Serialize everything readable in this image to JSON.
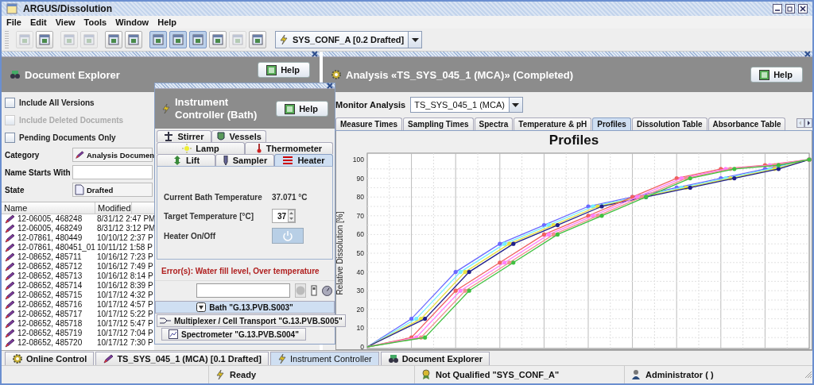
{
  "window": {
    "title": "ARGUS/Dissolution"
  },
  "menu": [
    "File",
    "Edit",
    "View",
    "Tools",
    "Window",
    "Help"
  ],
  "toolbar": {
    "groups": [
      [
        {
          "disabled": true,
          "pressed": false
        },
        {
          "disabled": false,
          "pressed": false
        }
      ],
      [
        {
          "disabled": true,
          "pressed": false
        },
        {
          "disabled": true,
          "pressed": false
        }
      ],
      [
        {
          "disabled": false,
          "pressed": false
        },
        {
          "disabled": false,
          "pressed": false
        }
      ],
      [
        {
          "disabled": false,
          "pressed": true
        },
        {
          "disabled": false,
          "pressed": true
        },
        {
          "disabled": false,
          "pressed": true
        },
        {
          "disabled": false,
          "pressed": false
        },
        {
          "disabled": true,
          "pressed": false
        },
        {
          "disabled": false,
          "pressed": false
        }
      ]
    ],
    "configuration": "SYS_CONF_A [0.2 Drafted]"
  },
  "document_explorer": {
    "title": "Document Explorer",
    "help": "Help",
    "options": [
      {
        "label": "Include All Versions",
        "checked": false,
        "disabled": false
      },
      {
        "label": "Include Deleted Documents",
        "checked": false,
        "disabled": true
      },
      {
        "label": "Pending Documents Only",
        "checked": false,
        "disabled": false
      }
    ],
    "category": {
      "label": "Category",
      "value": "Analysis Documen"
    },
    "name_filter": {
      "label": "Name Starts With"
    },
    "state": {
      "label": "State",
      "value": "Drafted"
    },
    "table": {
      "columns": [
        "Name",
        "Modified"
      ],
      "rows": [
        [
          "12-06005, 468248",
          "8/31/12 2:47 PM"
        ],
        [
          "12-06005, 468249",
          "8/31/12 3:12 PM"
        ],
        [
          "12-07861, 480449",
          "10/10/12 2:37 P"
        ],
        [
          "12-07861, 480451_01",
          "10/11/12 1:58 P"
        ],
        [
          "12-08652, 485711",
          "10/16/12 7:23 P"
        ],
        [
          "12-08652, 485712",
          "10/16/12 7:49 P"
        ],
        [
          "12-08652, 485713",
          "10/16/12 8:14 P"
        ],
        [
          "12-08652, 485714",
          "10/16/12 8:39 P"
        ],
        [
          "12-08652, 485715",
          "10/17/12 4:32 P"
        ],
        [
          "12-08652, 485716",
          "10/17/12 4:57 P"
        ],
        [
          "12-08652, 485717",
          "10/17/12 5:22 P"
        ],
        [
          "12-08652, 485718",
          "10/17/12 5:47 P"
        ],
        [
          "12-08652, 485719",
          "10/17/12 7:04 P"
        ],
        [
          "12-08652, 485720",
          "10/17/12 7:30 P"
        ]
      ]
    }
  },
  "analysis": {
    "title": "Analysis «TS_SYS_045_1 (MCA)» (Completed)",
    "help": "Help",
    "monitor": {
      "label": "Monitor Analysis",
      "value": "TS_SYS_045_1 (MCA)"
    },
    "tabs": [
      {
        "label": "Measure Times",
        "selected": false
      },
      {
        "label": "Sampling Times",
        "selected": false
      },
      {
        "label": "Spectra",
        "selected": false
      },
      {
        "label": "Temperature & pH",
        "selected": false
      },
      {
        "label": "Profiles",
        "selected": true
      },
      {
        "label": "Dissolution Table",
        "selected": false
      },
      {
        "label": "Absorbance Table",
        "selected": false
      }
    ],
    "chart": {
      "title": "Profiles",
      "ylabel": "Relative Dissolution [%]",
      "y_tick_labels": [
        "100",
        "90",
        "80",
        "70",
        "60",
        "50",
        "40",
        "30",
        "20",
        "10",
        "0"
      ]
    }
  },
  "instrument_controller": {
    "title": "Instrument Controller (Bath)",
    "help": "Help",
    "tab_rows": [
      [
        {
          "label": "Stirrer",
          "selected": false
        },
        {
          "label": "Vessels",
          "selected": false
        }
      ],
      [
        {
          "label": "Lamp",
          "selected": false
        },
        {
          "label": "Thermometer",
          "selected": false
        }
      ],
      [
        {
          "label": "Lift",
          "selected": false
        },
        {
          "label": "Sampler",
          "selected": false
        },
        {
          "label": "Heater",
          "selected": true
        }
      ]
    ],
    "fields": [
      {
        "kind": "reading",
        "label": "Current Bath Temperature",
        "value": "37.071 °C"
      },
      {
        "kind": "spinner",
        "label": "Target Temperature [°C]",
        "value": "37"
      },
      {
        "kind": "toggle",
        "label": "Heater On/Off",
        "on": true
      }
    ],
    "error": "Error(s): Water fill level, Over temperature",
    "instruments": [
      {
        "label": "Bath \"G.13.PVB.S003\"",
        "selected": true
      },
      {
        "label": "Multiplexer / Cell Transport \"G.13.PVB.S005\"",
        "selected": false
      },
      {
        "label": "Spectrometer \"G.13.PVB.S004\"",
        "selected": false
      }
    ]
  },
  "bottom_tabs": [
    {
      "label": "Online Control",
      "selected": false
    },
    {
      "label": "TS_SYS_045_1 (MCA) [0.1 Drafted]",
      "selected": false
    },
    {
      "label": "Instrument Controller",
      "selected": true
    },
    {
      "label": "Document Explorer",
      "selected": false
    }
  ],
  "status_bar": {
    "status": "Ready",
    "qualification": "Not Qualified \"SYS_CONF_A\"",
    "user": "Administrator ( )"
  }
}
